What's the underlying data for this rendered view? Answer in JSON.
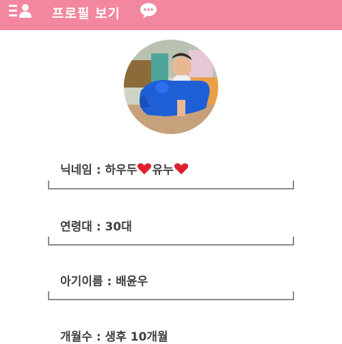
{
  "header": {
    "title": "프로필 보기",
    "color": "#f2879f",
    "menu_icon": "profile-menu-icon",
    "chat_icon": "speech-bubble-icon"
  },
  "profile": {
    "avatar_description_icon": "baby-avatar-photo",
    "fields": [
      {
        "label": "닉네임 : 하우두",
        "mid": "유누"
      },
      {
        "label": "연령대 : 30대"
      },
      {
        "label": "아기이름 : 배윤우"
      },
      {
        "label": "개월수 : 생후 10개월"
      }
    ],
    "heart_color": "#e0202e",
    "underline_color": "#8a8a8a"
  }
}
